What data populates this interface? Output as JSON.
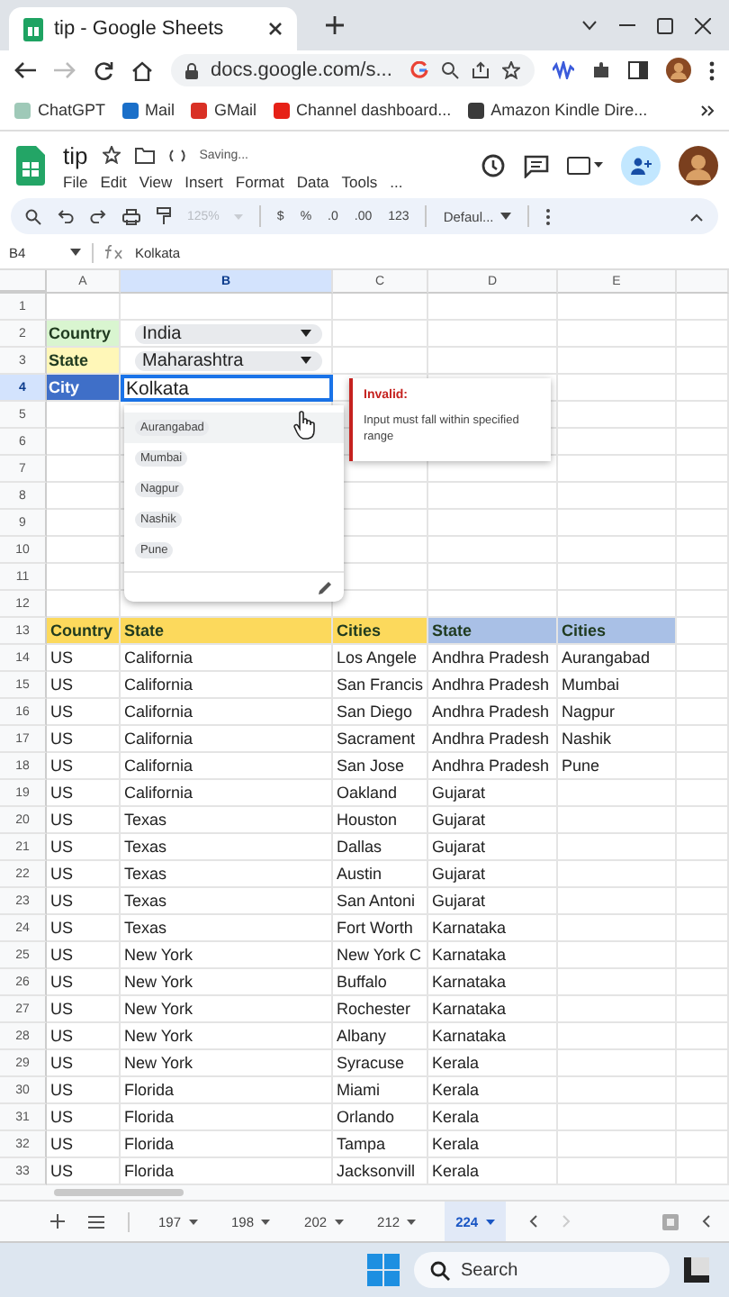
{
  "browser": {
    "tabs": [
      {
        "title": "tip - Google Sheets",
        "selected": true
      }
    ],
    "address": "docs.google.com/s...",
    "bookmarks": [
      {
        "label": "ChatGPT",
        "color": "#9fc9b8"
      },
      {
        "label": "Mail",
        "color": "#1a6fc9"
      },
      {
        "label": "GMail",
        "color": "#d93025"
      },
      {
        "label": "Channel dashboard...",
        "color": "#e62117"
      },
      {
        "label": "Amazon Kindle Dire...",
        "color": "#3a3a3a"
      }
    ]
  },
  "sheet": {
    "title": "tip",
    "status": "Saving...",
    "menus": [
      "File",
      "Edit",
      "View",
      "Insert",
      "Format",
      "Data",
      "Tools",
      "..."
    ]
  },
  "toolbar": {
    "zoom": {
      "label": "125%",
      "disabled": true
    },
    "buttons": [
      "$",
      "%",
      ".0",
      ".00",
      "123"
    ],
    "font": "Defaul..."
  },
  "formula_bar": {
    "cell": "B4",
    "value": "Kolkata"
  },
  "grid": {
    "columns": [
      {
        "label": "A",
        "selected": false
      },
      {
        "label": "B",
        "selected": true
      },
      {
        "label": "C",
        "selected": false
      },
      {
        "label": "D",
        "selected": false
      },
      {
        "label": "E",
        "selected": false
      }
    ],
    "rows": [
      {
        "number": "1",
        "selected": false
      },
      {
        "number": "2",
        "selected": false,
        "cells": {
          "A": {
            "text": "Country",
            "kind": "label",
            "color": "#d9f5d0"
          },
          "B": {
            "text": "India",
            "kind": "chip"
          }
        }
      },
      {
        "number": "3",
        "selected": false,
        "cells": {
          "A": {
            "text": "State",
            "kind": "label",
            "color": "#fff7b8"
          },
          "B": {
            "text": "Maharashtra",
            "kind": "chip"
          }
        }
      },
      {
        "number": "4",
        "selected": true,
        "cells": {
          "A": {
            "text": "City",
            "kind": "label",
            "color": "#3f6fc8"
          },
          "B": {
            "text": "Kolkata",
            "kind": "editing"
          }
        }
      },
      {
        "number": "5",
        "selected": false
      },
      {
        "number": "6",
        "selected": false
      },
      {
        "number": "7",
        "selected": false
      },
      {
        "number": "8",
        "selected": false
      },
      {
        "number": "9",
        "selected": false
      },
      {
        "number": "10",
        "selected": false
      },
      {
        "number": "11",
        "selected": false
      },
      {
        "number": "12",
        "selected": false
      },
      {
        "number": "13",
        "selected": false,
        "cells": {
          "A": {
            "text": "Country",
            "kind": "header",
            "color": "#fcd95c"
          },
          "B": {
            "text": "State",
            "kind": "header",
            "color": "#fcd95c"
          },
          "C": {
            "text": "Cities",
            "kind": "header",
            "color": "#fcd95c"
          },
          "D": {
            "text": "State",
            "kind": "header",
            "color": "#a9c0e6"
          },
          "E": {
            "text": "Cities",
            "kind": "header",
            "color": "#a9c0e6"
          }
        }
      },
      {
        "number": "14",
        "selected": false,
        "cells": {
          "A": "US",
          "B": "California",
          "C": "Los Angele",
          "D": "Andhra Pradesh",
          "E": "Aurangabad"
        }
      },
      {
        "number": "15",
        "selected": false,
        "cells": {
          "A": "US",
          "B": "California",
          "C": "San Francis",
          "D": "Andhra Pradesh",
          "E": "Mumbai"
        }
      },
      {
        "number": "16",
        "selected": false,
        "cells": {
          "A": "US",
          "B": "California",
          "C": "San Diego",
          "D": "Andhra Pradesh",
          "E": "Nagpur"
        }
      },
      {
        "number": "17",
        "selected": false,
        "cells": {
          "A": "US",
          "B": "California",
          "C": "Sacrament",
          "D": "Andhra Pradesh",
          "E": "Nashik"
        }
      },
      {
        "number": "18",
        "selected": false,
        "cells": {
          "A": "US",
          "B": "California",
          "C": "San Jose",
          "D": "Andhra Pradesh",
          "E": "Pune"
        }
      },
      {
        "number": "19",
        "selected": false,
        "cells": {
          "A": "US",
          "B": "California",
          "C": "Oakland",
          "D": "Gujarat"
        }
      },
      {
        "number": "20",
        "selected": false,
        "cells": {
          "A": "US",
          "B": "Texas",
          "C": "Houston",
          "D": "Gujarat"
        }
      },
      {
        "number": "21",
        "selected": false,
        "cells": {
          "A": "US",
          "B": "Texas",
          "C": "Dallas",
          "D": "Gujarat"
        }
      },
      {
        "number": "22",
        "selected": false,
        "cells": {
          "A": "US",
          "B": "Texas",
          "C": "Austin",
          "D": "Gujarat"
        }
      },
      {
        "number": "23",
        "selected": false,
        "cells": {
          "A": "US",
          "B": "Texas",
          "C": "San Antoni",
          "D": "Gujarat"
        }
      },
      {
        "number": "24",
        "selected": false,
        "cells": {
          "A": "US",
          "B": "Texas",
          "C": "Fort Worth",
          "D": "Karnataka"
        }
      },
      {
        "number": "25",
        "selected": false,
        "cells": {
          "A": "US",
          "B": "New York",
          "C": "New York C",
          "D": "Karnataka"
        }
      },
      {
        "number": "26",
        "selected": false,
        "cells": {
          "A": "US",
          "B": "New York",
          "C": "Buffalo",
          "D": "Karnataka"
        }
      },
      {
        "number": "27",
        "selected": false,
        "cells": {
          "A": "US",
          "B": "New York",
          "C": "Rochester",
          "D": "Karnataka"
        }
      },
      {
        "number": "28",
        "selected": false,
        "cells": {
          "A": "US",
          "B": "New York",
          "C": "Albany",
          "D": "Karnataka"
        }
      },
      {
        "number": "29",
        "selected": false,
        "cells": {
          "A": "US",
          "B": "New York",
          "C": "Syracuse",
          "D": "Kerala"
        }
      },
      {
        "number": "30",
        "selected": false,
        "cells": {
          "A": "US",
          "B": "Florida",
          "C": "Miami",
          "D": "Kerala"
        }
      },
      {
        "number": "31",
        "selected": false,
        "cells": {
          "A": "US",
          "B": "Florida",
          "C": "Orlando",
          "D": "Kerala"
        }
      },
      {
        "number": "32",
        "selected": false,
        "cells": {
          "A": "US",
          "B": "Florida",
          "C": "Tampa",
          "D": "Kerala"
        }
      },
      {
        "number": "33",
        "selected": false,
        "cells": {
          "A": "US",
          "B": "Florida",
          "C": "Jacksonvill",
          "D": "Kerala"
        }
      }
    ]
  },
  "dropdown": {
    "options": [
      {
        "label": "Aurangabad",
        "hovered": true
      },
      {
        "label": "Mumbai",
        "hovered": false
      },
      {
        "label": "Nagpur",
        "hovered": false
      },
      {
        "label": "Nashik",
        "hovered": false
      },
      {
        "label": "Pune",
        "hovered": false
      }
    ]
  },
  "validation": {
    "title": "Invalid:",
    "message": "Input must fall within specified range"
  },
  "sheet_tabs": [
    {
      "label": "197",
      "selected": false
    },
    {
      "label": "198",
      "selected": false
    },
    {
      "label": "202",
      "selected": false
    },
    {
      "label": "212",
      "selected": false
    },
    {
      "label": "224",
      "selected": true
    }
  ],
  "taskbar": {
    "search_placeholder": "Search"
  }
}
